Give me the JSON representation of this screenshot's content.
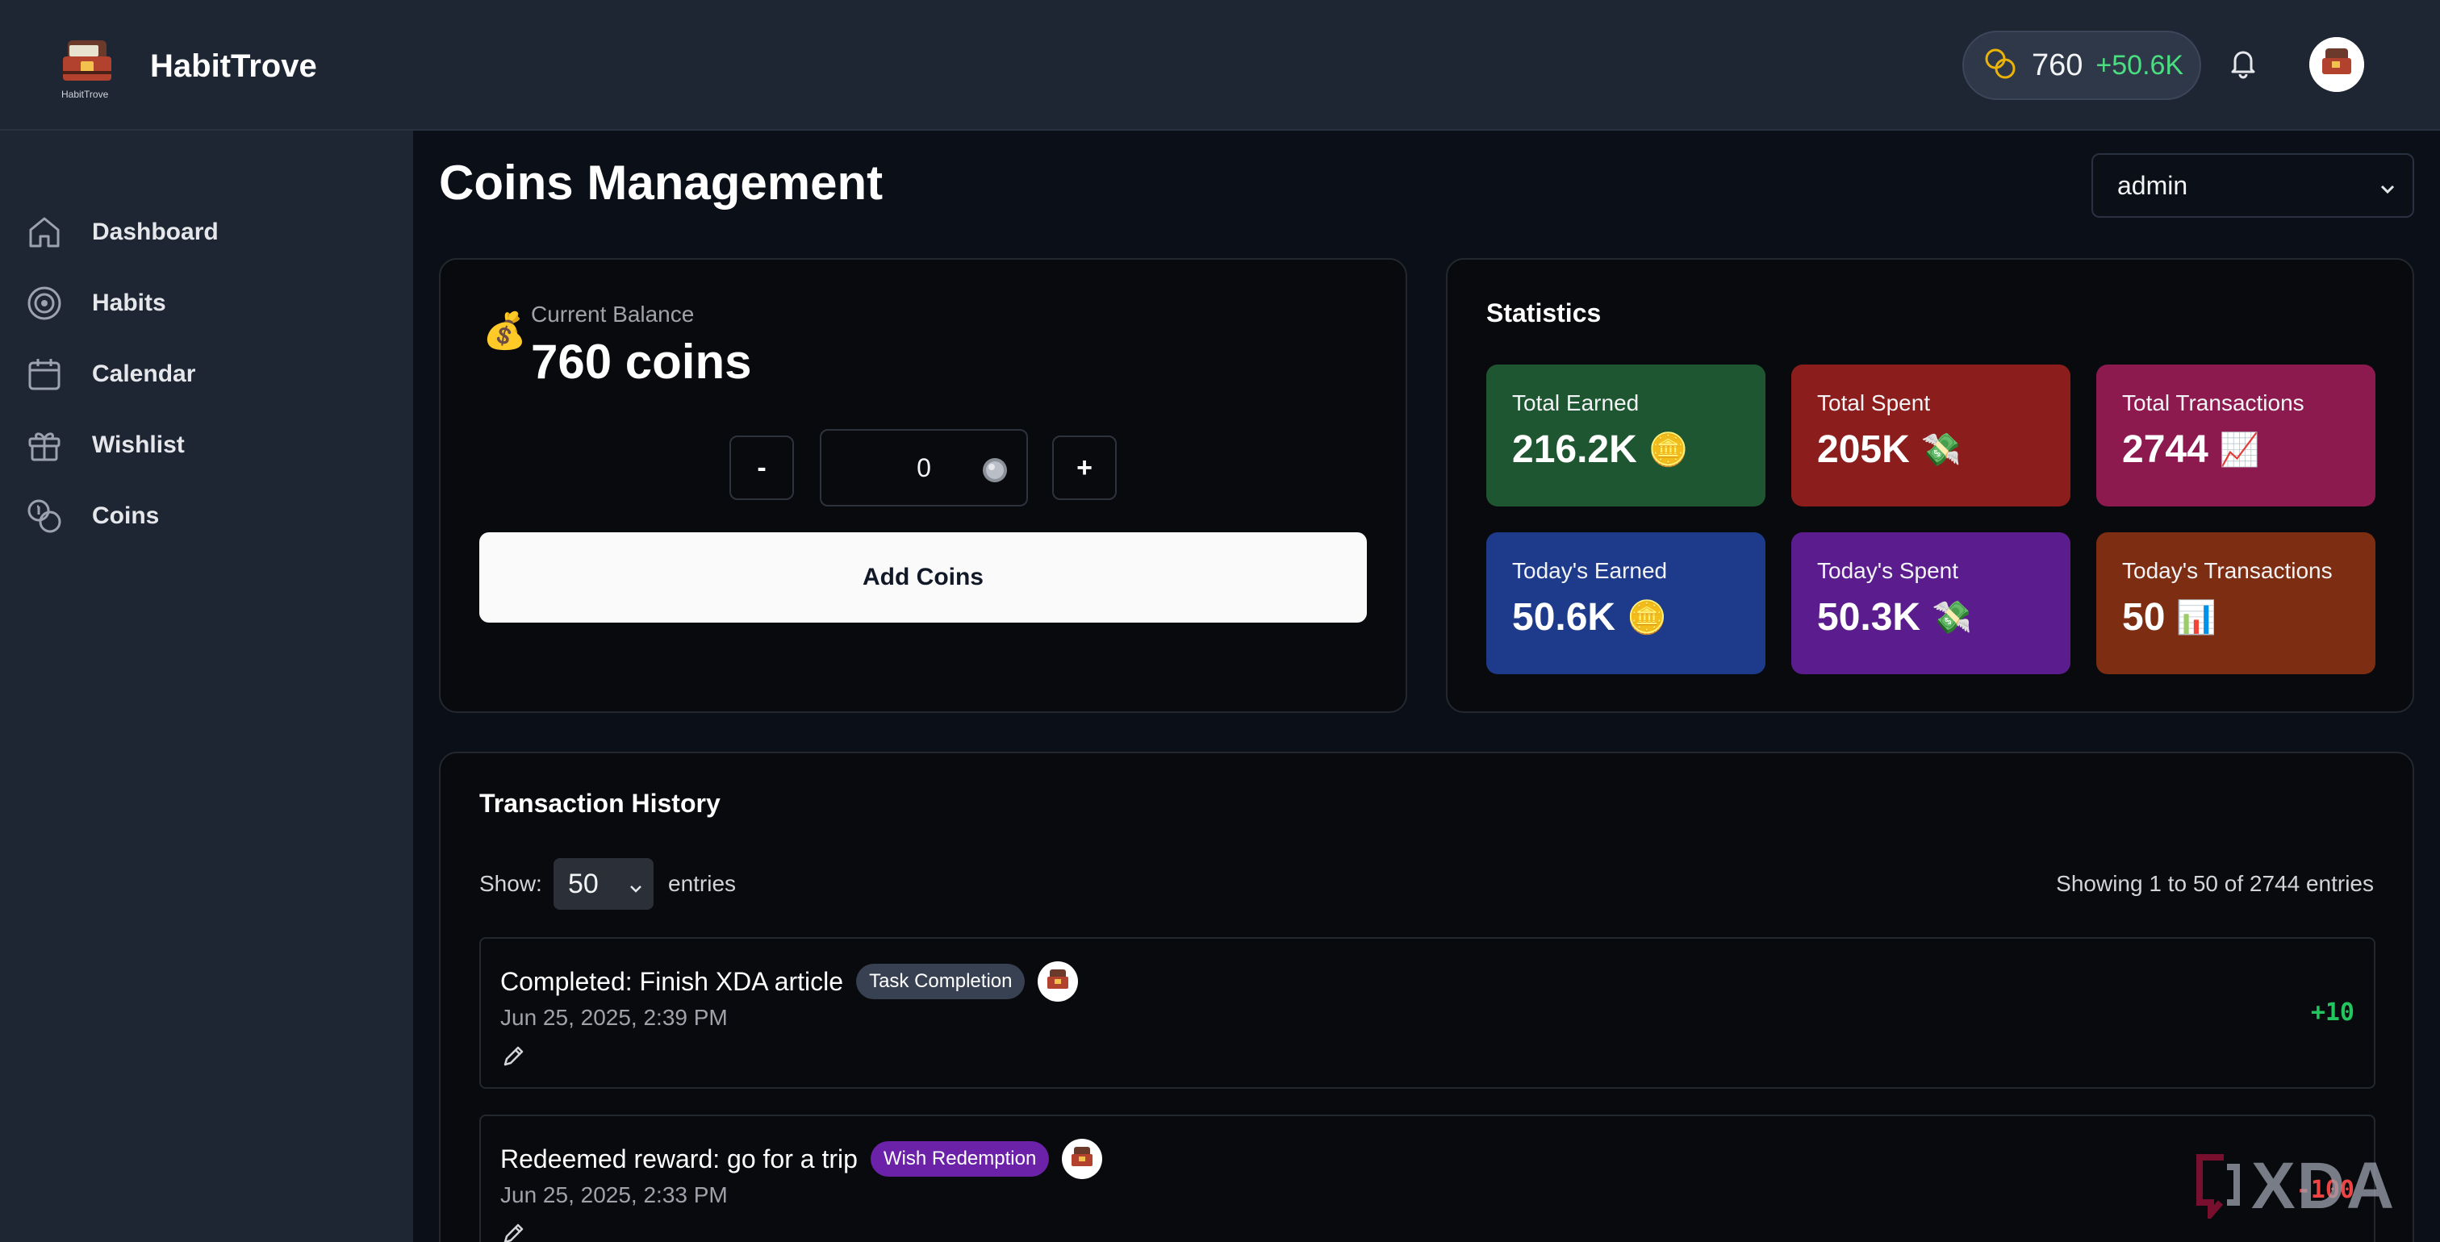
{
  "app": {
    "name": "HabitTrove",
    "logo_text": "HabitTrove"
  },
  "header": {
    "coins": "760",
    "coins_delta": "+50.6K"
  },
  "sidebar": {
    "items": [
      {
        "label": "Dashboard",
        "icon": "home-icon"
      },
      {
        "label": "Habits",
        "icon": "target-icon"
      },
      {
        "label": "Calendar",
        "icon": "calendar-icon"
      },
      {
        "label": "Wishlist",
        "icon": "gift-icon"
      },
      {
        "label": "Coins",
        "icon": "coins-icon"
      }
    ]
  },
  "page": {
    "title": "Coins Management",
    "user_select": "admin"
  },
  "balance": {
    "label": "Current Balance",
    "value": "760 coins",
    "bag_emoji": "💰",
    "minus_label": "-",
    "plus_label": "+",
    "amount": "0",
    "add_label": "Add Coins"
  },
  "statistics": {
    "title": "Statistics",
    "tiles": [
      {
        "label": "Total Earned",
        "value": "216.2K",
        "emoji": "🪙",
        "color": "#1e5631"
      },
      {
        "label": "Total Spent",
        "value": "205K",
        "emoji": "💸",
        "color": "#8b1d1d"
      },
      {
        "label": "Total Transactions",
        "value": "2744",
        "emoji": "📈",
        "color": "#8c1a4f"
      },
      {
        "label": "Today's Earned",
        "value": "50.6K",
        "emoji": "🪙",
        "color": "#1e3a8a"
      },
      {
        "label": "Today's Spent",
        "value": "50.3K",
        "emoji": "💸",
        "color": "#5b1d8e"
      },
      {
        "label": "Today's Transactions",
        "value": "50",
        "emoji": "📊",
        "color": "#7c2d12"
      }
    ]
  },
  "history": {
    "title": "Transaction History",
    "show_label": "Show:",
    "page_size": "50",
    "entries_label": "entries",
    "showing": "Showing 1 to 50 of 2744 entries",
    "rows": [
      {
        "description": "Completed: Finish XDA article",
        "tag": "Task Completion",
        "date": "Jun 25, 2025, 2:39 PM",
        "amount": "+10"
      },
      {
        "description": "Redeemed reward: go for a trip",
        "tag": "Wish Redemption",
        "date": "Jun 25, 2025, 2:33 PM",
        "amount": "-100"
      }
    ]
  },
  "watermark": {
    "text": "XDA"
  },
  "colors": {
    "positive": "#22c55e",
    "negative": "#ef4444",
    "sidebar_bg": "#1e2533",
    "page_bg": "#0b0f17"
  }
}
